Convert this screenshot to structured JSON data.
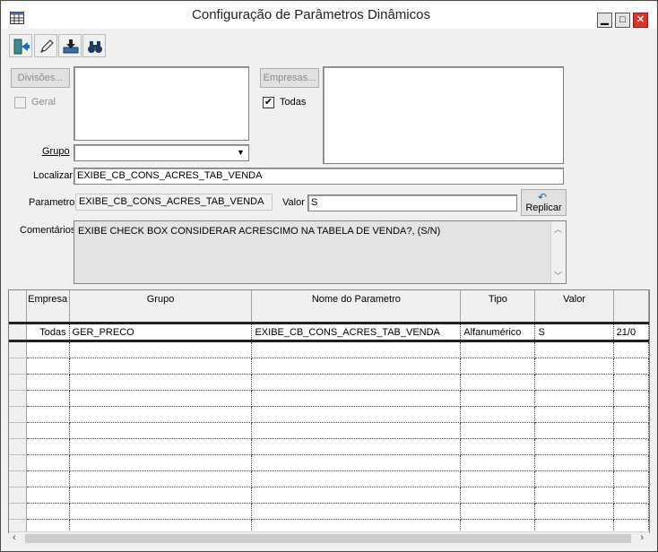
{
  "window": {
    "title": "Configuração de Parâmetros Dinâmicos",
    "minimize": "▁",
    "maximize": "□",
    "close": "✕"
  },
  "toolbar": [
    "exit-icon",
    "pencil-icon",
    "save-tray-icon",
    "binoculars-icon"
  ],
  "divisoes": {
    "button": "Divisões...",
    "geral_label": "Geral",
    "geral_checked": false
  },
  "empresas": {
    "button": "Empresas...",
    "todas_label": "Todas",
    "todas_checked": true,
    "check_mark": "✔"
  },
  "grupo": {
    "label": "Grupo",
    "value": ""
  },
  "localizar": {
    "label": "Localizar",
    "value": "EXIBE_CB_CONS_ACRES_TAB_VENDA"
  },
  "parametro": {
    "label": "Parametro",
    "value": "EXIBE_CB_CONS_ACRES_TAB_VENDA"
  },
  "valor": {
    "label": "Valor",
    "value": "S"
  },
  "replicar": {
    "label": "Replicar"
  },
  "comentarios": {
    "label": "Comentários",
    "value": "EXIBE CHECK BOX CONSIDERAR ACRESCIMO NA TABELA DE VENDA?, (S/N)"
  },
  "table": {
    "columns": [
      "Empresa",
      "Grupo",
      "Nome do Parametro",
      "Tipo",
      "Valor",
      ""
    ],
    "rows": [
      [
        "Todas",
        "GER_PRECO",
        "EXIBE_CB_CONS_ACRES_TAB_VENDA",
        "Alfanumérico",
        "S",
        "21/0"
      ]
    ]
  }
}
